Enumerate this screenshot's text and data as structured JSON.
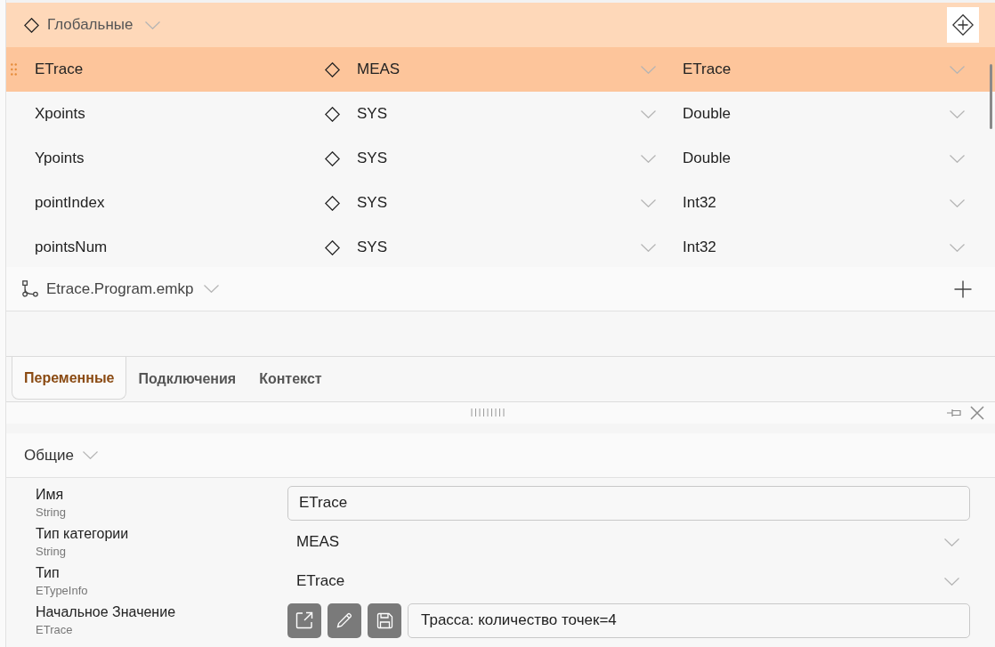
{
  "globals_group": {
    "title": "Глобальные"
  },
  "variables": [
    {
      "name": "ETrace",
      "category": "MEAS",
      "type": "ETrace",
      "selected": true
    },
    {
      "name": "Xpoints",
      "category": "SYS",
      "type": "Double",
      "selected": false
    },
    {
      "name": "Ypoints",
      "category": "SYS",
      "type": "Double",
      "selected": false
    },
    {
      "name": "pointIndex",
      "category": "SYS",
      "type": "Int32",
      "selected": false
    },
    {
      "name": "pointsNum",
      "category": "SYS",
      "type": "Int32",
      "selected": false
    }
  ],
  "program_group": {
    "title": "Etrace.Program.emkp"
  },
  "tabs": [
    {
      "label": "Переменные",
      "selected": true
    },
    {
      "label": "Подключения",
      "selected": false
    },
    {
      "label": "Контекст",
      "selected": false
    }
  ],
  "section": {
    "title": "Общие"
  },
  "properties": [
    {
      "kind": "text",
      "label": "Имя",
      "type": "String",
      "value": "ETrace"
    },
    {
      "kind": "dropdown",
      "label": "Тип категории",
      "type": "String",
      "value": "MEAS"
    },
    {
      "kind": "dropdown",
      "label": "Тип",
      "type": "ETypeInfo",
      "value": "ETrace"
    },
    {
      "kind": "object",
      "label": "Начальное Значение",
      "type": "ETrace",
      "value": "Трасса: количество точек=4"
    }
  ]
}
